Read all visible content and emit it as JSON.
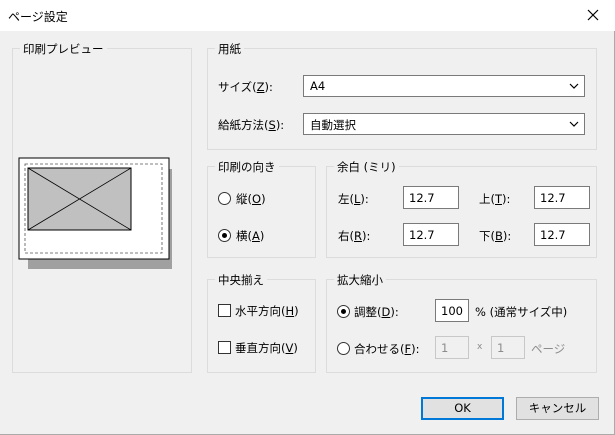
{
  "window": {
    "title": "ページ設定",
    "close_icon": "close-icon"
  },
  "preview": {
    "group_label": "印刷プレビュー"
  },
  "paper": {
    "group_label": "用紙",
    "size_label": "サイズ(",
    "size_key": "Z",
    "size_end": "):",
    "size_value": "A4",
    "source_label": "給紙方法(",
    "source_key": "S",
    "source_end": "):",
    "source_value": "自動選択"
  },
  "orientation": {
    "group_label": "印刷の向き",
    "portrait_label": "縦(",
    "portrait_key": "O",
    "portrait_end": ")",
    "landscape_label": "横(",
    "landscape_key": "A",
    "landscape_end": ")",
    "selected": "landscape"
  },
  "margins": {
    "group_label": "余白 (ミリ)",
    "left_label": "左(",
    "left_key": "L",
    "left_end": "):",
    "left_value": "12.7",
    "top_label": "上(",
    "top_key": "T",
    "top_end": "):",
    "top_value": "12.7",
    "right_label": "右(",
    "right_key": "R",
    "right_end": "):",
    "right_value": "12.7",
    "bottom_label": "下(",
    "bottom_key": "B",
    "bottom_end": "):",
    "bottom_value": "12.7"
  },
  "center": {
    "group_label": "中央揃え",
    "horizontal_label": "水平方向(",
    "horizontal_key": "H",
    "horizontal_end": ")",
    "vertical_label": "垂直方向(",
    "vertical_key": "V",
    "vertical_end": ")"
  },
  "scaling": {
    "group_label": "拡大縮小",
    "adjust_label": "調整(",
    "adjust_key": "D",
    "adjust_end": "):",
    "adjust_value": "100",
    "adjust_suffix": "% (通常サイズ中)",
    "fit_label": "合わせる(",
    "fit_key": "F",
    "fit_end": "):",
    "fit_width": "1",
    "fit_x": "x",
    "fit_height": "1",
    "fit_pages": "ページ"
  },
  "buttons": {
    "ok": "OK",
    "cancel": "キャンセル"
  }
}
